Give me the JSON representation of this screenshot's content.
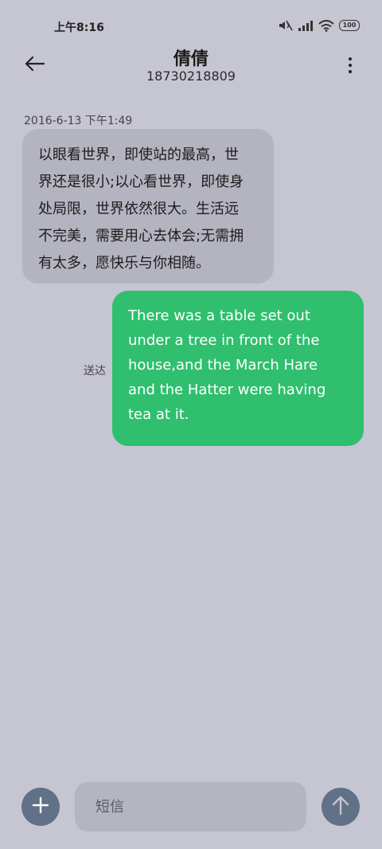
{
  "status_bar": {
    "time": "上午8:16",
    "battery": "100",
    "icons": [
      "mute-icon",
      "signal-icon",
      "wifi-icon",
      "battery-icon"
    ]
  },
  "header": {
    "contact_name": "倩倩",
    "phone_number": "18730218809",
    "icons": [
      "back-arrow-icon",
      "more-vertical-icon"
    ]
  },
  "conversation": {
    "timestamp": "2016-6-13 下午1:49",
    "incoming_message": {
      "lines": [
        "以眼看世界，即使站的最高，世",
        "界还是很小;以心看世界，即使身",
        "处局限，世界依然很大。生活远",
        "不完美，需要用心去体会;无需拥",
        "有太多，愿快乐与你相随。"
      ]
    },
    "outgoing_message": {
      "lines": [
        "There was a table set out",
        "under a tree in front of the",
        "house,and the March Hare",
        "and the Hatter were having",
        "tea at it."
      ],
      "status": "送达"
    }
  },
  "composer": {
    "placeholder": "短信",
    "icons": [
      "plus-icon",
      "send-arrow-icon"
    ]
  },
  "colors": {
    "background": "#c6c6d2",
    "incoming_bubble": "#b4b4c0",
    "outgoing_bubble": "#2fbf6e",
    "button": "#617187"
  }
}
